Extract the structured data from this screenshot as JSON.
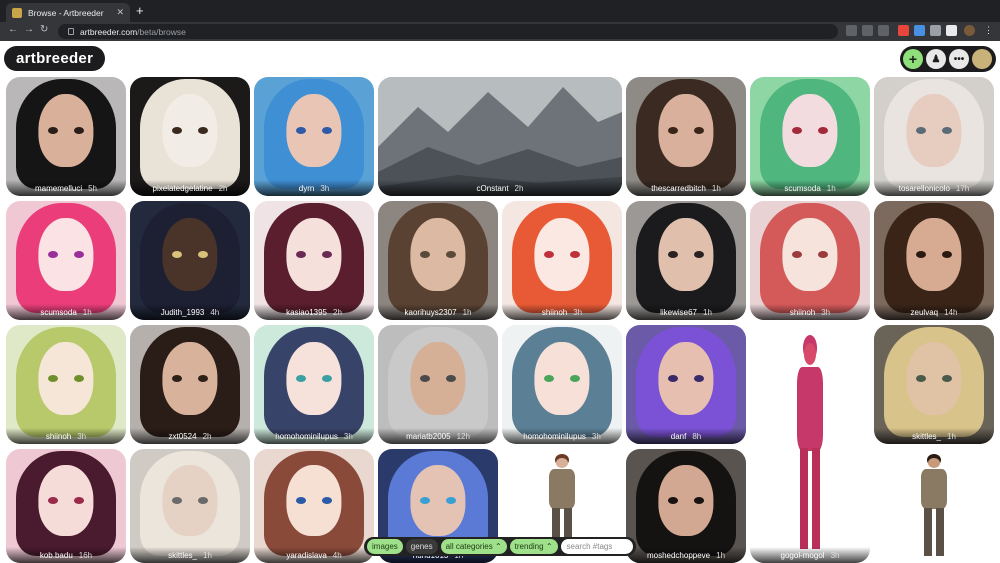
{
  "browser": {
    "tab_title": "Browse - Artbreeder",
    "url_host": "artbreeder.com",
    "url_path": "/beta/browse"
  },
  "header": {
    "logo": "artbreeder",
    "add_icon": "plus-icon",
    "bell_icon": "bell-icon",
    "more_icon": "more-icon"
  },
  "tiles": [
    {
      "user": "mamemelluci",
      "age": "5h",
      "theme": "boy-black-hair"
    },
    {
      "user": "pixelatedgelatine",
      "age": "2h",
      "theme": "dog"
    },
    {
      "user": "dyrn",
      "age": "3h",
      "theme": "blue-hair-girl"
    },
    {
      "user": "cOnstant",
      "age": "2h",
      "theme": "mountains"
    },
    {
      "user": "thescarredbitch",
      "age": "1h",
      "theme": "brown-hair-woman"
    },
    {
      "user": "scumsoda",
      "age": "1h",
      "theme": "green-anime"
    },
    {
      "user": "tosarellonicolo",
      "age": "17h",
      "theme": "white-hair-woman"
    },
    {
      "user": "scumsoda",
      "age": "1h",
      "theme": "pink-anime"
    },
    {
      "user": "Judith_1993",
      "age": "4h",
      "theme": "dark-portrait"
    },
    {
      "user": "kasiao1395",
      "age": "2h",
      "theme": "maroon-anime"
    },
    {
      "user": "kaorihuys2307",
      "age": "1h",
      "theme": "brunette-woman"
    },
    {
      "user": "shiinoh",
      "age": "3h",
      "theme": "red-anime"
    },
    {
      "user": "likewise67",
      "age": "1h",
      "theme": "black-curly-woman"
    },
    {
      "user": "shiinoh",
      "age": "3h",
      "theme": "floral-anime"
    },
    {
      "user": "zeulvaq",
      "age": "14h",
      "theme": "curly-brunette"
    },
    {
      "user": "shiinoh",
      "age": "3h",
      "theme": "green-hair-anime"
    },
    {
      "user": "zxt0524",
      "age": "2h",
      "theme": "dark-hair-woman"
    },
    {
      "user": "homohominilupus",
      "age": "3h",
      "theme": "blue-anime-cat"
    },
    {
      "user": "mariatb2005",
      "age": "12h",
      "theme": "silver-hair-man"
    },
    {
      "user": "homohominilupus",
      "age": "3h",
      "theme": "teal-anime"
    },
    {
      "user": "danf",
      "age": "8h",
      "theme": "purple-hair-woman"
    },
    {
      "user": "gogol-mogol",
      "age": "3h",
      "theme": "pink-warrior"
    },
    {
      "user": "skittles_",
      "age": "1h",
      "theme": "golden-curly"
    },
    {
      "user": "kob.badu",
      "age": "16h",
      "theme": "anime-dark-hair"
    },
    {
      "user": "skittles_",
      "age": "1h",
      "theme": "pale-curly"
    },
    {
      "user": "yaradislava",
      "age": "4h",
      "theme": "brown-anime"
    },
    {
      "user": "nunu1013",
      "age": "1h",
      "theme": "blue-pink-hair"
    },
    {
      "user": "",
      "age": "",
      "theme": "full-body-woman"
    },
    {
      "user": "moshedchoppeve",
      "age": "1h",
      "theme": "dark-woman"
    },
    {
      "user": "",
      "age": "",
      "theme": "full-body-man"
    }
  ],
  "filters": {
    "images": "images",
    "genes": "genes",
    "category": "all categories",
    "sort": "trending",
    "search_placeholder": "search #tags"
  }
}
